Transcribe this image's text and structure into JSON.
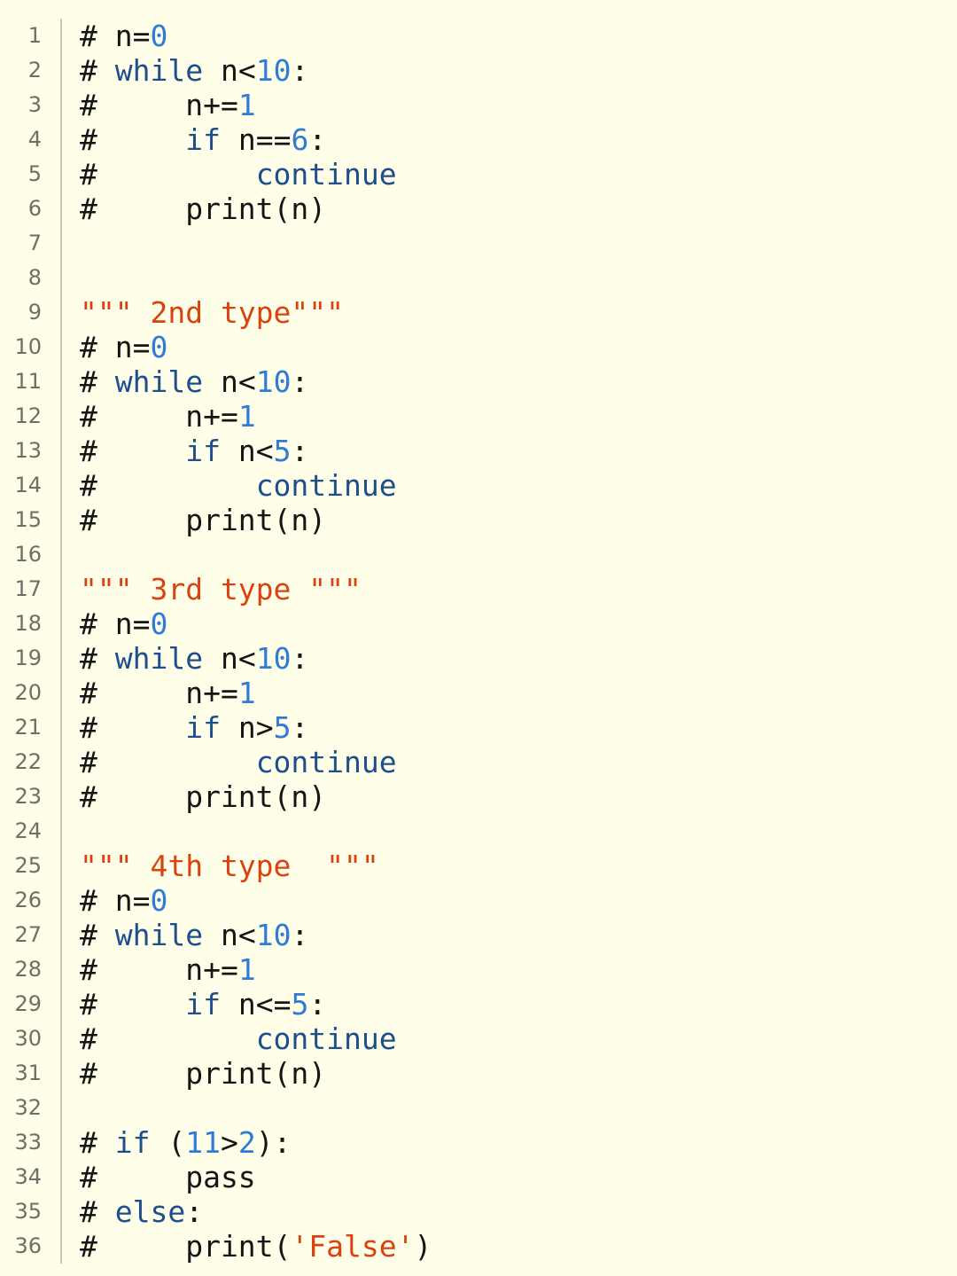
{
  "editor": {
    "colors": {
      "background": "#fefee9",
      "keyword": "#1f4e8c",
      "number": "#2f7bd6",
      "string": "#d9430f",
      "text": "#151515",
      "line_number": "#6e6e66"
    },
    "lines": [
      {
        "num": "1",
        "tokens": [
          {
            "t": "# n=",
            "c": "txt"
          },
          {
            "t": "0",
            "c": "num"
          }
        ]
      },
      {
        "num": "2",
        "tokens": [
          {
            "t": "# ",
            "c": "txt"
          },
          {
            "t": "while",
            "c": "kw"
          },
          {
            "t": " n<",
            "c": "txt"
          },
          {
            "t": "10",
            "c": "num"
          },
          {
            "t": ":",
            "c": "txt"
          }
        ]
      },
      {
        "num": "3",
        "tokens": [
          {
            "t": "#     n+=",
            "c": "txt"
          },
          {
            "t": "1",
            "c": "num"
          }
        ]
      },
      {
        "num": "4",
        "tokens": [
          {
            "t": "#     ",
            "c": "txt"
          },
          {
            "t": "if",
            "c": "kw"
          },
          {
            "t": " n==",
            "c": "txt"
          },
          {
            "t": "6",
            "c": "num"
          },
          {
            "t": ":",
            "c": "txt"
          }
        ]
      },
      {
        "num": "5",
        "tokens": [
          {
            "t": "#         ",
            "c": "txt"
          },
          {
            "t": "continue",
            "c": "kw"
          }
        ]
      },
      {
        "num": "6",
        "tokens": [
          {
            "t": "#     print(n)",
            "c": "txt"
          }
        ]
      },
      {
        "num": "7",
        "tokens": []
      },
      {
        "num": "8",
        "tokens": []
      },
      {
        "num": "9",
        "tokens": [
          {
            "t": "\"\"\" 2nd type\"\"\"",
            "c": "str"
          }
        ]
      },
      {
        "num": "10",
        "tokens": [
          {
            "t": "# n=",
            "c": "txt"
          },
          {
            "t": "0",
            "c": "num"
          }
        ]
      },
      {
        "num": "11",
        "tokens": [
          {
            "t": "# ",
            "c": "txt"
          },
          {
            "t": "while",
            "c": "kw"
          },
          {
            "t": " n<",
            "c": "txt"
          },
          {
            "t": "10",
            "c": "num"
          },
          {
            "t": ":",
            "c": "txt"
          }
        ]
      },
      {
        "num": "12",
        "tokens": [
          {
            "t": "#     n+=",
            "c": "txt"
          },
          {
            "t": "1",
            "c": "num"
          }
        ]
      },
      {
        "num": "13",
        "tokens": [
          {
            "t": "#     ",
            "c": "txt"
          },
          {
            "t": "if",
            "c": "kw"
          },
          {
            "t": " n<",
            "c": "txt"
          },
          {
            "t": "5",
            "c": "num"
          },
          {
            "t": ":",
            "c": "txt"
          }
        ]
      },
      {
        "num": "14",
        "tokens": [
          {
            "t": "#         ",
            "c": "txt"
          },
          {
            "t": "continue",
            "c": "kw"
          }
        ]
      },
      {
        "num": "15",
        "tokens": [
          {
            "t": "#     print(n)",
            "c": "txt"
          }
        ]
      },
      {
        "num": "16",
        "tokens": []
      },
      {
        "num": "17",
        "tokens": [
          {
            "t": "\"\"\" 3rd type \"\"\"",
            "c": "str"
          }
        ]
      },
      {
        "num": "18",
        "tokens": [
          {
            "t": "# n=",
            "c": "txt"
          },
          {
            "t": "0",
            "c": "num"
          }
        ]
      },
      {
        "num": "19",
        "tokens": [
          {
            "t": "# ",
            "c": "txt"
          },
          {
            "t": "while",
            "c": "kw"
          },
          {
            "t": " n<",
            "c": "txt"
          },
          {
            "t": "10",
            "c": "num"
          },
          {
            "t": ":",
            "c": "txt"
          }
        ]
      },
      {
        "num": "20",
        "tokens": [
          {
            "t": "#     n+=",
            "c": "txt"
          },
          {
            "t": "1",
            "c": "num"
          }
        ]
      },
      {
        "num": "21",
        "tokens": [
          {
            "t": "#     ",
            "c": "txt"
          },
          {
            "t": "if",
            "c": "kw"
          },
          {
            "t": " n>",
            "c": "txt"
          },
          {
            "t": "5",
            "c": "num"
          },
          {
            "t": ":",
            "c": "txt"
          }
        ]
      },
      {
        "num": "22",
        "tokens": [
          {
            "t": "#         ",
            "c": "txt"
          },
          {
            "t": "continue",
            "c": "kw"
          }
        ]
      },
      {
        "num": "23",
        "tokens": [
          {
            "t": "#     print(n)",
            "c": "txt"
          }
        ]
      },
      {
        "num": "24",
        "tokens": []
      },
      {
        "num": "25",
        "tokens": [
          {
            "t": "\"\"\" 4th type  \"\"\"",
            "c": "str"
          }
        ]
      },
      {
        "num": "26",
        "tokens": [
          {
            "t": "# n=",
            "c": "txt"
          },
          {
            "t": "0",
            "c": "num"
          }
        ]
      },
      {
        "num": "27",
        "tokens": [
          {
            "t": "# ",
            "c": "txt"
          },
          {
            "t": "while",
            "c": "kw"
          },
          {
            "t": " n<",
            "c": "txt"
          },
          {
            "t": "10",
            "c": "num"
          },
          {
            "t": ":",
            "c": "txt"
          }
        ]
      },
      {
        "num": "28",
        "tokens": [
          {
            "t": "#     n+=",
            "c": "txt"
          },
          {
            "t": "1",
            "c": "num"
          }
        ]
      },
      {
        "num": "29",
        "tokens": [
          {
            "t": "#     ",
            "c": "txt"
          },
          {
            "t": "if",
            "c": "kw"
          },
          {
            "t": " n<=",
            "c": "txt"
          },
          {
            "t": "5",
            "c": "num"
          },
          {
            "t": ":",
            "c": "txt"
          }
        ]
      },
      {
        "num": "30",
        "tokens": [
          {
            "t": "#         ",
            "c": "txt"
          },
          {
            "t": "continue",
            "c": "kw"
          }
        ]
      },
      {
        "num": "31",
        "tokens": [
          {
            "t": "#     print(n)",
            "c": "txt"
          }
        ]
      },
      {
        "num": "32",
        "tokens": []
      },
      {
        "num": "33",
        "tokens": [
          {
            "t": "# ",
            "c": "txt"
          },
          {
            "t": "if",
            "c": "kw"
          },
          {
            "t": " (",
            "c": "txt"
          },
          {
            "t": "11",
            "c": "num"
          },
          {
            "t": ">",
            "c": "txt"
          },
          {
            "t": "2",
            "c": "num"
          },
          {
            "t": "):",
            "c": "txt"
          }
        ]
      },
      {
        "num": "34",
        "tokens": [
          {
            "t": "#     pass",
            "c": "txt"
          }
        ]
      },
      {
        "num": "35",
        "tokens": [
          {
            "t": "# ",
            "c": "txt"
          },
          {
            "t": "else",
            "c": "kw"
          },
          {
            "t": ":",
            "c": "txt"
          }
        ]
      },
      {
        "num": "36",
        "tokens": [
          {
            "t": "#     print(",
            "c": "txt"
          },
          {
            "t": "'False'",
            "c": "str"
          },
          {
            "t": ")",
            "c": "txt"
          }
        ]
      }
    ]
  }
}
